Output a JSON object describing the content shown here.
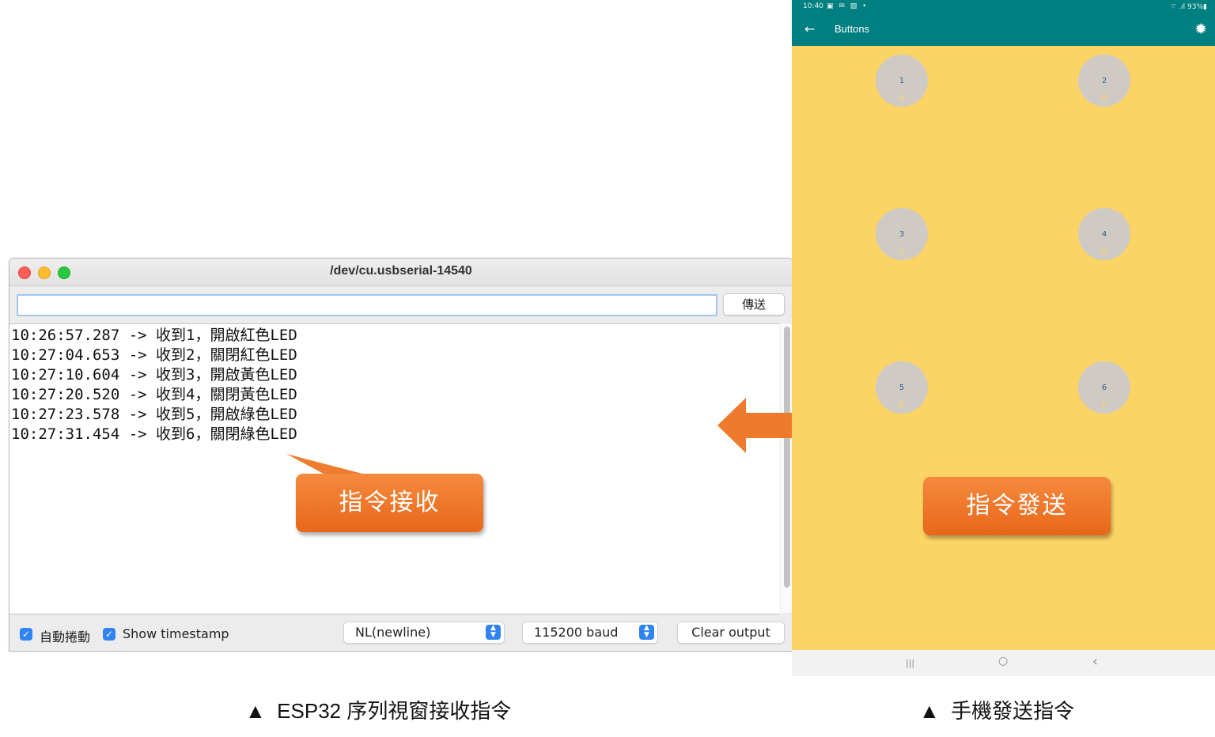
{
  "serial_monitor": {
    "title": "/dev/cu.usbserial-14540",
    "input_value": "",
    "send_button": "傳送",
    "output_lines": [
      "10:26:57.287 -> 收到1，開啟紅色LED",
      "10:27:04.653 -> 收到2，關閉紅色LED",
      "10:27:10.604 -> 收到3，開啟黃色LED",
      "10:27:20.520 -> 收到4，關閉黃色LED",
      "10:27:23.578 -> 收到5，開啟綠色LED",
      "10:27:31.454 -> 收到6，關閉綠色LED"
    ],
    "autoscroll_label": "自動捲動",
    "autoscroll_checked": true,
    "timestamp_label": "Show timestamp",
    "timestamp_checked": true,
    "line_ending": "NL(newline)",
    "baud_rate": "115200 baud",
    "clear_button": "Clear output"
  },
  "callouts": {
    "receive": "指令接收",
    "send": "指令發送"
  },
  "phone": {
    "status_time": "10:40",
    "status_icons": "▣ ✉ ▨ •",
    "status_right": "⌔ .ıl 93%▮",
    "back_icon": "←",
    "app_title": "Buttons",
    "settings_icon": "gear-icon",
    "buttons": [
      {
        "number": "1",
        "letter": "A"
      },
      {
        "number": "2",
        "letter": "B"
      },
      {
        "number": "3",
        "letter": "C"
      },
      {
        "number": "4",
        "letter": "D"
      },
      {
        "number": "5",
        "letter": "E"
      },
      {
        "number": "6",
        "letter": "F"
      }
    ],
    "nav": {
      "recents": "|||",
      "home": "○",
      "back": "‹"
    }
  },
  "captions": {
    "left": "▲  ESP32 序列視窗接收指令",
    "right": "▲  手機發送指令"
  },
  "colors": {
    "accent_orange": "#ee7a2c",
    "phone_bg": "#fcd365",
    "app_bar": "#007f80",
    "checkbox_blue": "#2f84f2"
  }
}
